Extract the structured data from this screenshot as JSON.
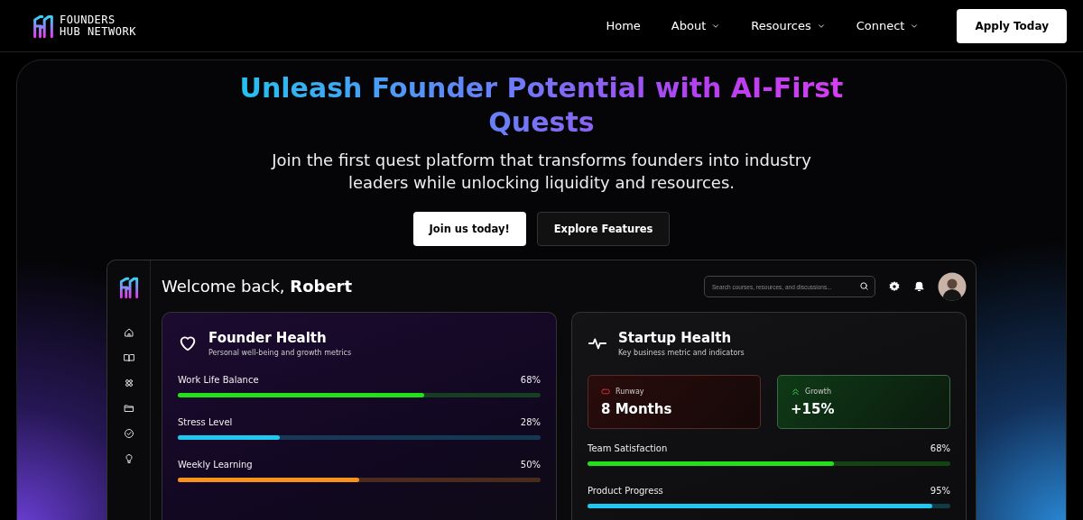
{
  "nav": {
    "logo": {
      "line1": "FOUNDERS",
      "line2": "HUB NETWORK"
    },
    "links": [
      {
        "label": "Home",
        "dropdown": false
      },
      {
        "label": "About",
        "dropdown": true
      },
      {
        "label": "Resources",
        "dropdown": true
      },
      {
        "label": "Connect",
        "dropdown": true
      }
    ],
    "cta": "Apply Today"
  },
  "hero": {
    "title": "Unleash Founder Potential with AI-First Quests",
    "subtitle": "Join the first quest platform that transforms founders into industry leaders while unlocking liquidity and resources.",
    "buttons": [
      {
        "label": "Join us today!",
        "kind": "primary"
      },
      {
        "label": "Explore Features",
        "kind": "secondary"
      }
    ]
  },
  "dashboard": {
    "greeting": "Welcome back, **Robert**",
    "search": {
      "placeholder": "Search courses, resources, and discussions..."
    },
    "sidebar": [
      {
        "kind": "home"
      },
      {
        "kind": "book"
      },
      {
        "kind": "group"
      },
      {
        "kind": "folder"
      },
      {
        "kind": "check"
      },
      {
        "kind": "bulb"
      }
    ],
    "cards": [
      {
        "kind": "founder",
        "title": "Founder Health",
        "subtitle": "Personal well-being and growth metrics",
        "metrics": [
          {
            "label": "Work Life Balance",
            "value": "68%",
            "level": 0.68,
            "color": "#22e01a"
          },
          {
            "label": "Stress Level",
            "value": "28%",
            "level": 0.28,
            "color": "#1ec8f0"
          },
          {
            "label": "Weekly Learning",
            "value": "50%",
            "level": 0.5,
            "color": "#f7931a"
          }
        ]
      },
      {
        "kind": "startup",
        "title": "Startup Health",
        "subtitle": "Key business metric and indicators",
        "stats": [
          {
            "kind": "runway",
            "label": "Runway",
            "value": "8 Months"
          },
          {
            "kind": "growth",
            "label": "Growth",
            "value": "+15%"
          }
        ],
        "metrics": [
          {
            "label": "Team Satisfaction",
            "value": "68%",
            "level": 0.68,
            "color": "#22e01a"
          },
          {
            "label": "Product Progress",
            "value": "95%",
            "level": 0.95,
            "color": "#1ec8f0"
          }
        ]
      }
    ]
  }
}
